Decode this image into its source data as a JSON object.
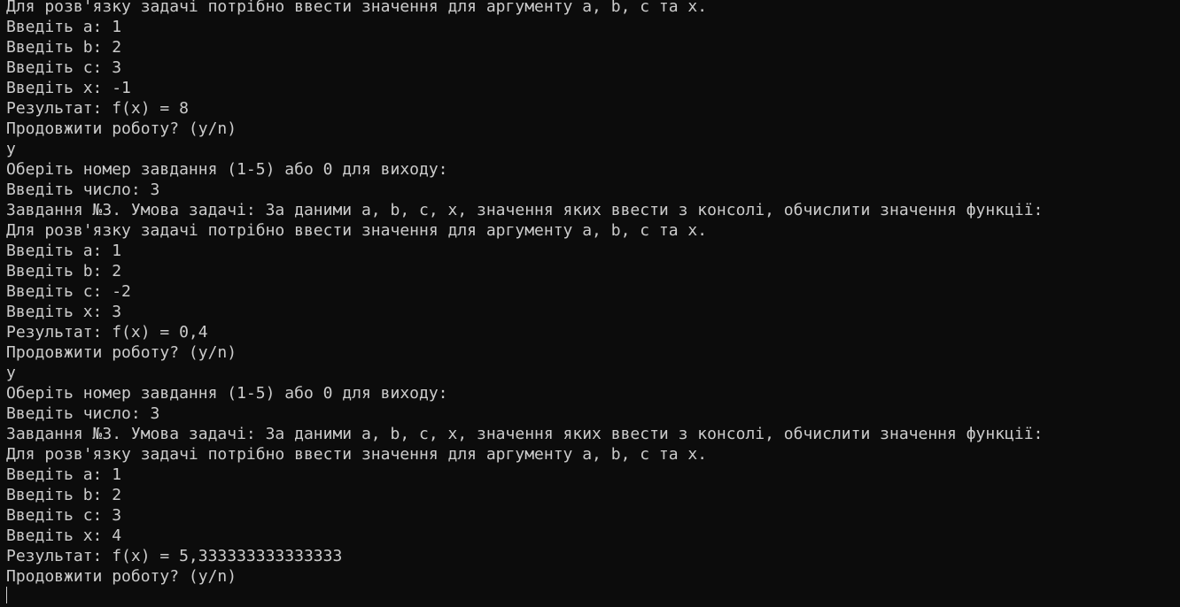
{
  "terminal": {
    "lines": [
      "Для розв'язку задачі потрібно ввести значення для аргументу a, b, c та x.",
      "Введіть a: 1",
      "Введіть b: 2",
      "Введіть c: 3",
      "Введіть x: -1",
      "Результат: f(x) = 8",
      "Продовжити роботу? (y/n)",
      "y",
      "Оберіть номер завдання (1-5) або 0 для виходу:",
      "Введіть число: 3",
      "Завдання №3. Умова задачі: За даними a, b, c, x, значення яких ввести з консолі, обчислити значення функції:",
      "Для розв'язку задачі потрібно ввести значення для аргументу a, b, c та x.",
      "Введіть a: 1",
      "Введіть b: 2",
      "Введіть c: -2",
      "Введіть x: 3",
      "Результат: f(x) = 0,4",
      "Продовжити роботу? (y/n)",
      "y",
      "Оберіть номер завдання (1-5) або 0 для виходу:",
      "Введіть число: 3",
      "Завдання №3. Умова задачі: За даними a, b, c, x, значення яких ввести з консолі, обчислити значення функції:",
      "Для розв'язку задачі потрібно ввести значення для аргументу a, b, c та x.",
      "Введіть a: 1",
      "Введіть b: 2",
      "Введіть c: 3",
      "Введіть x: 4",
      "Результат: f(x) = 5,333333333333333",
      "Продовжити роботу? (y/n)"
    ]
  },
  "colors": {
    "background": "#0c0c0c",
    "foreground": "#cccccc"
  }
}
